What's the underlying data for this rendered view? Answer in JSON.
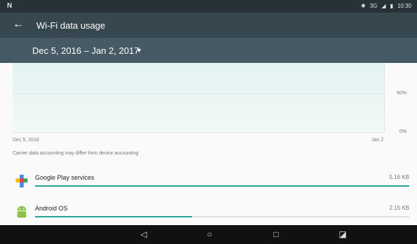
{
  "status_bar": {
    "left_icon": "N",
    "network": "3G",
    "time": "10:30"
  },
  "app_bar": {
    "title": "Wi-Fi data usage",
    "back_icon": "arrow-left-icon"
  },
  "cycle": {
    "label": "Dec 5, 2016 – Jan 2, 2017",
    "dropdown_icon": "caret-down-icon"
  },
  "chart": {
    "pct_top": "50%",
    "pct_bottom": "0%",
    "start_label": "Dec 5, 2016",
    "end_label": "Jan 2"
  },
  "note": "Carrier data accounting may differ from device accounting",
  "apps": [
    {
      "name": "Google Play services",
      "size": "5.16 KB",
      "fraction": 1.0,
      "icon": "google-play-services-icon"
    },
    {
      "name": "Android OS",
      "size": "2.15 KB",
      "fraction": 0.42,
      "icon": "android-icon"
    }
  ],
  "nav": [
    "back-icon",
    "home-icon",
    "recents-icon",
    "screenshot-icon"
  ],
  "colors": {
    "accent": "#26a69a",
    "appbar": "#37474f",
    "subbar": "#455a64"
  }
}
